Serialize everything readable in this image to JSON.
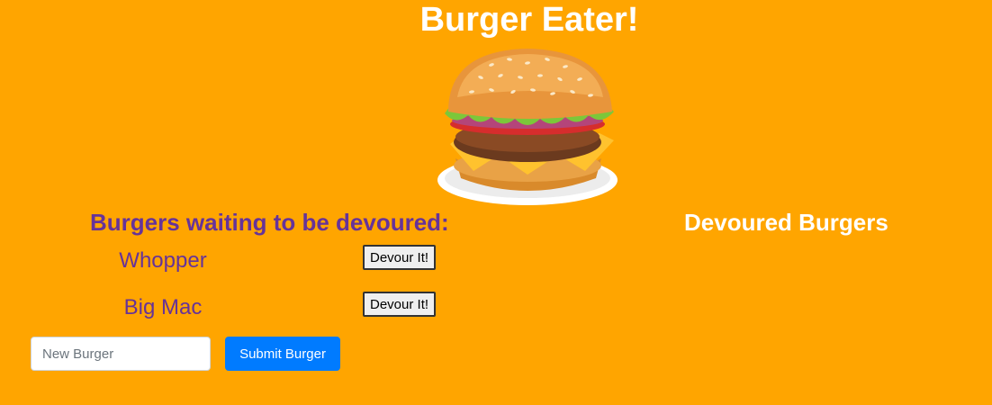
{
  "header": {
    "title": "Burger Eater!"
  },
  "hero": {
    "image_icon": "burger-illustration"
  },
  "waiting": {
    "heading": "Burgers waiting to be devoured:",
    "burgers": [
      {
        "name": "Whopper",
        "button_label": "Devour It!"
      },
      {
        "name": "Big Mac",
        "button_label": "Devour It!"
      }
    ]
  },
  "devoured": {
    "heading": "Devoured Burgers",
    "burgers": []
  },
  "form": {
    "input_placeholder": "New Burger",
    "input_value": "",
    "submit_label": "Submit Burger"
  },
  "colors": {
    "background": "#ffa500",
    "heading_purple": "#663399",
    "title_white": "#ffffff",
    "submit_blue": "#007bff"
  }
}
